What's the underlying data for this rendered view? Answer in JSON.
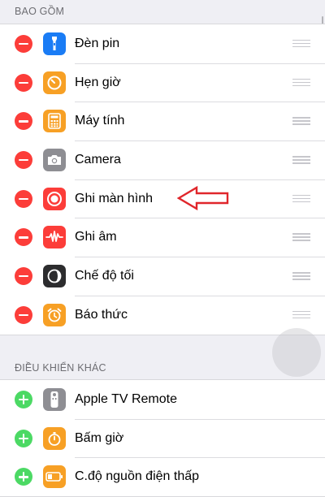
{
  "sections": {
    "included": {
      "header": "BAO GỒM",
      "items": [
        {
          "label": "Đèn pin",
          "icon": "flashlight-icon",
          "color": "#1a7cf5"
        },
        {
          "label": "Hẹn giờ",
          "icon": "timer-icon",
          "color": "#f7a025"
        },
        {
          "label": "Máy tính",
          "icon": "calculator-icon",
          "color": "#f7a025"
        },
        {
          "label": "Camera",
          "icon": "camera-icon",
          "color": "#8e8e93"
        },
        {
          "label": "Ghi màn hình",
          "icon": "screen-recording-icon",
          "color": "#fc3d39"
        },
        {
          "label": "Ghi âm",
          "icon": "voice-memos-icon",
          "color": "#fc3d39"
        },
        {
          "label": "Chế độ tối",
          "icon": "dark-mode-icon",
          "color": "#2c2c2e"
        },
        {
          "label": "Báo thức",
          "icon": "alarm-icon",
          "color": "#f7a025"
        }
      ]
    },
    "more": {
      "header": "ĐIỀU KHIỂN KHÁC",
      "items": [
        {
          "label": "Apple TV Remote",
          "icon": "apple-tv-remote-icon",
          "color": "#8e8e93"
        },
        {
          "label": "Bấm giờ",
          "icon": "stopwatch-icon",
          "color": "#f7a025"
        },
        {
          "label": "C.độ nguồn điện thấp",
          "icon": "low-power-mode-icon",
          "color": "#f7a025"
        }
      ]
    }
  },
  "colors": {
    "remove": "#fc3d39",
    "add": "#4cd964",
    "annotation_arrow": "#e0262b"
  }
}
